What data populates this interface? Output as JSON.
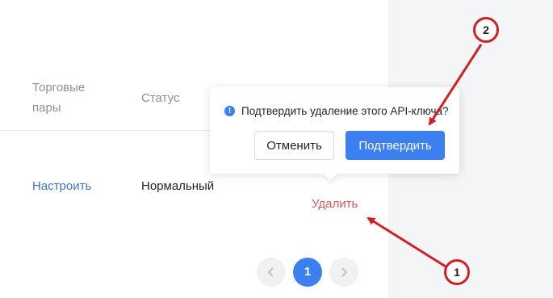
{
  "table": {
    "col_pairs": "Торговые пары",
    "col_status": "Статус",
    "row": {
      "configure_link": "Настроить",
      "status_value": "Нормальный",
      "delete_link": "Удалить"
    }
  },
  "popconfirm": {
    "message": "Подтвердить удаление этого API-ключа?",
    "info_icon": "!",
    "cancel_label": "Отменить",
    "confirm_label": "Подтвердить"
  },
  "pagination": {
    "current_page": "1",
    "prev_icon": "chevron-left-icon",
    "next_icon": "chevron-right-icon"
  },
  "annotations": {
    "step_1": "1",
    "step_2": "2",
    "color": "#d21f24"
  },
  "colors": {
    "primary": "#3b7ff0",
    "link": "#3d74c9",
    "danger": "#e0555a",
    "side_panel": "#f4f5f7"
  }
}
